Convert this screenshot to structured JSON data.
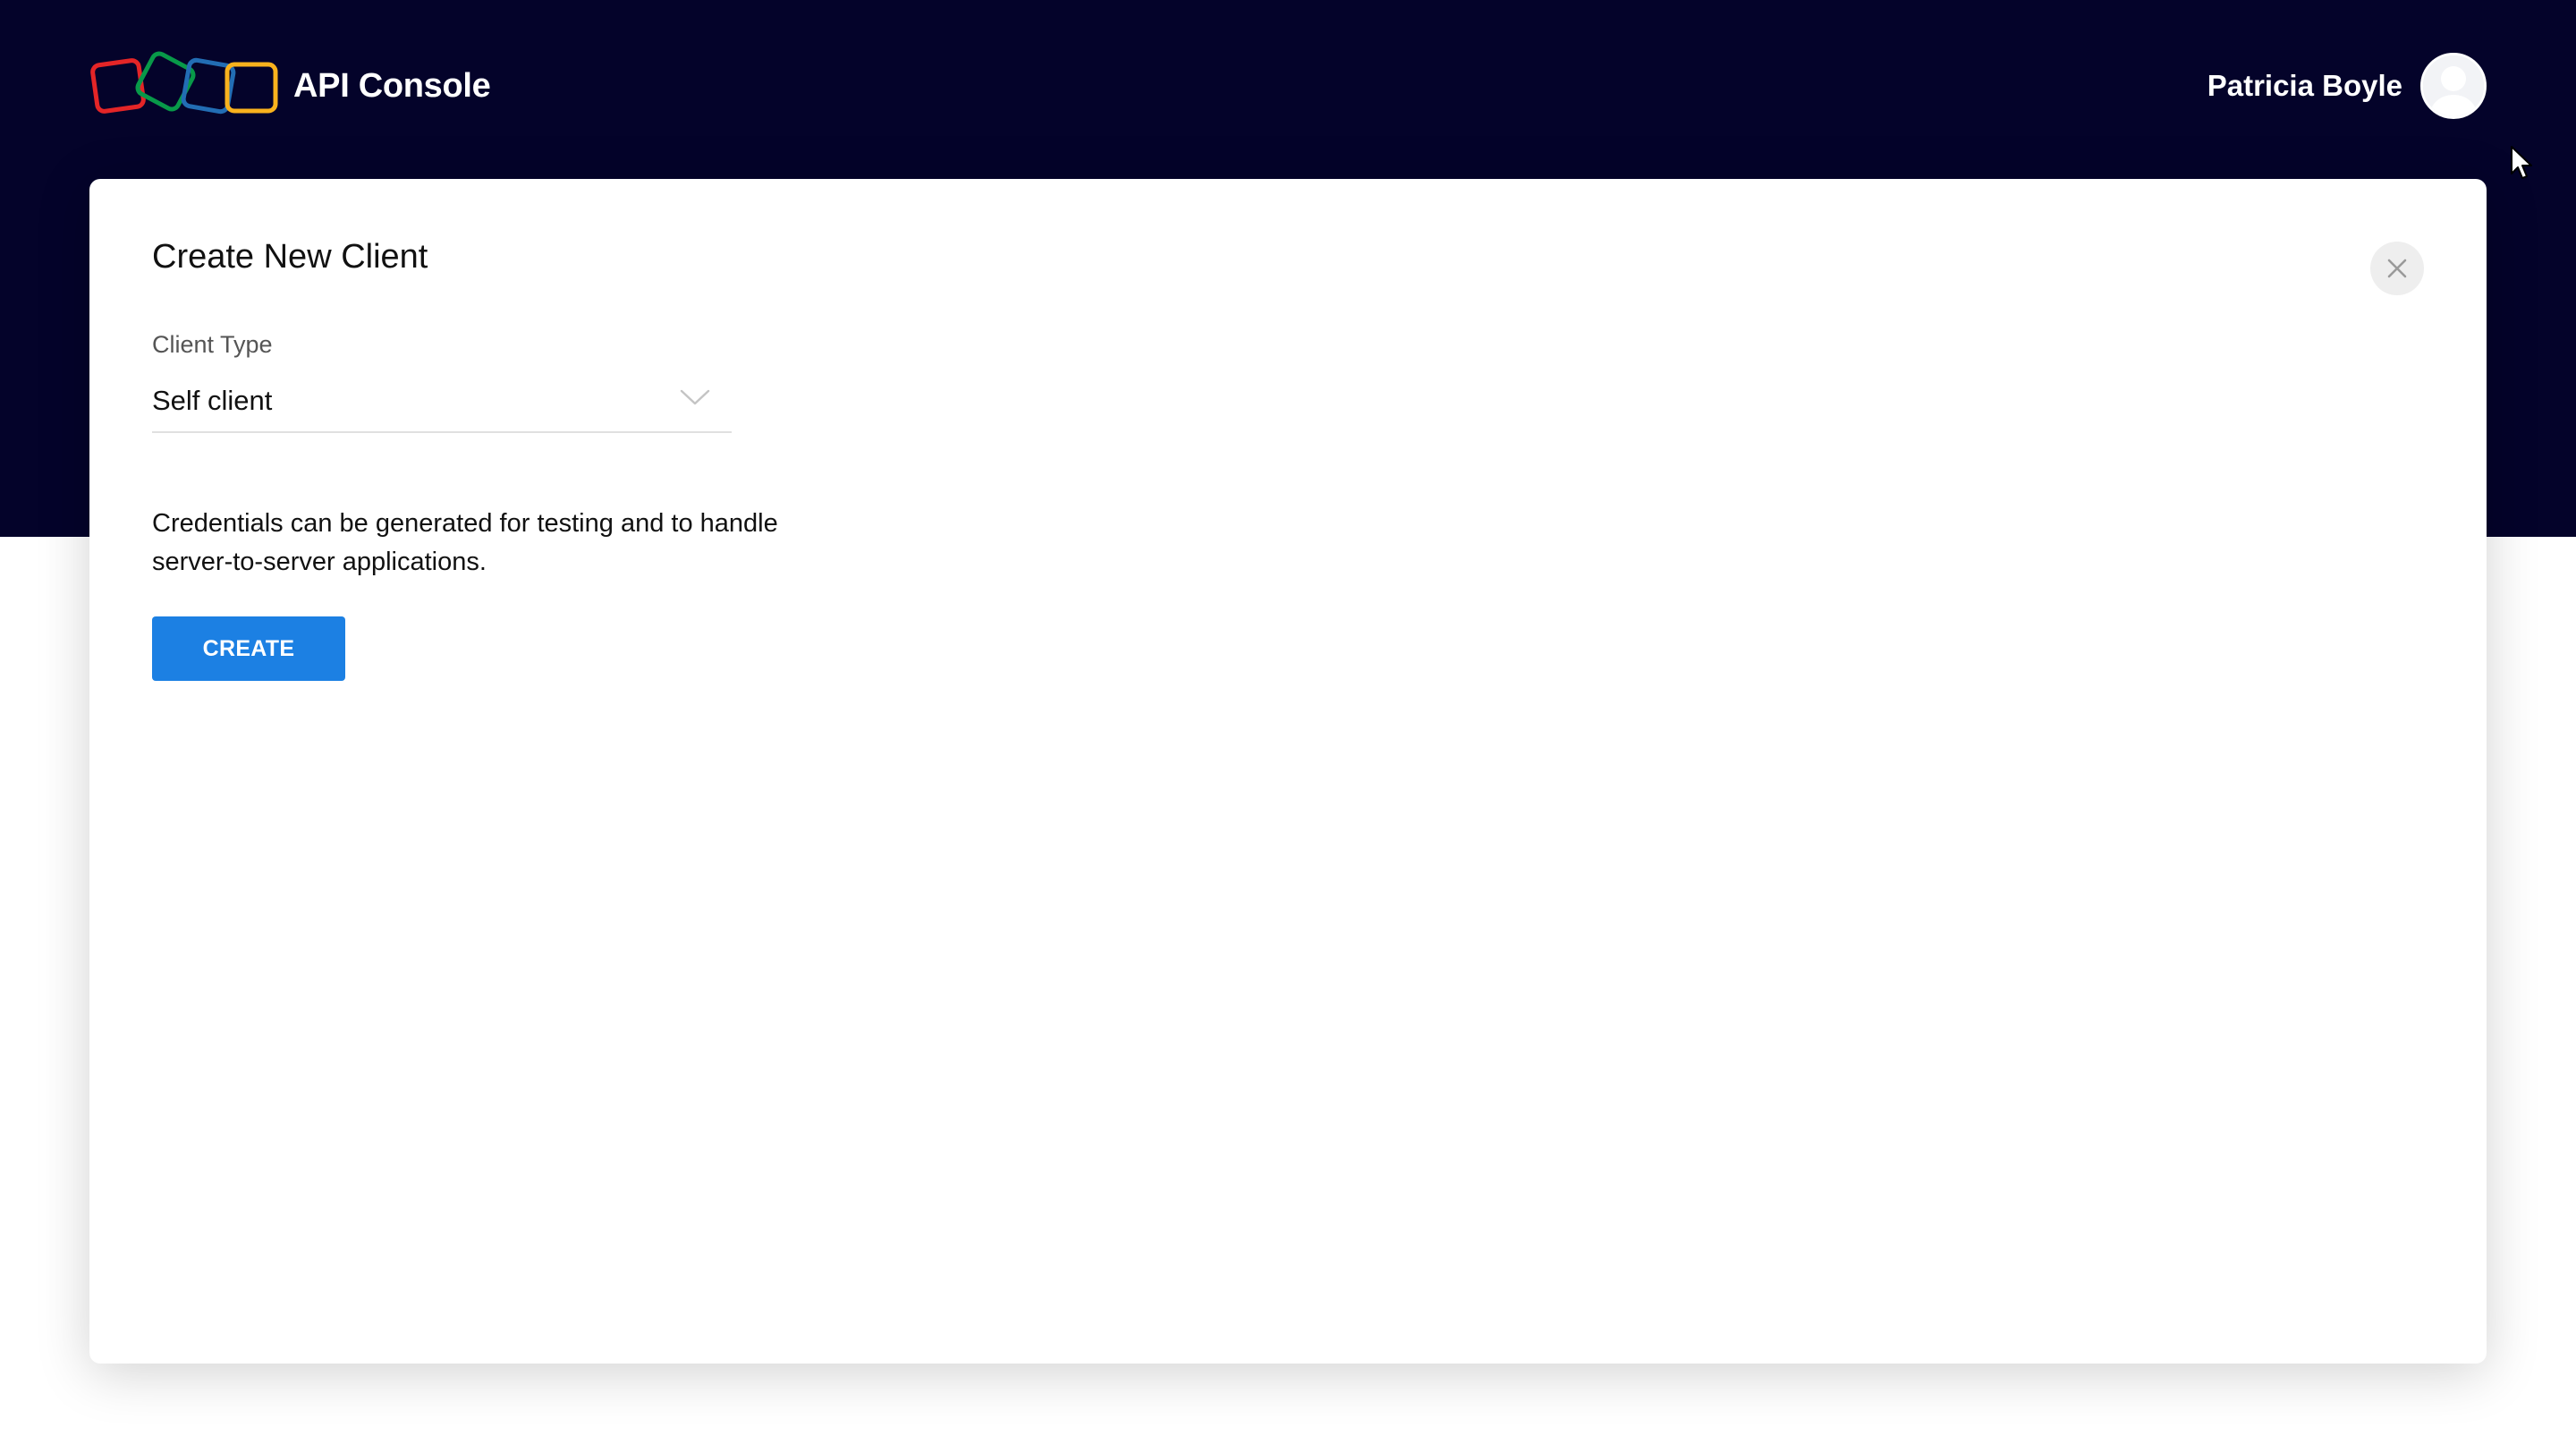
{
  "header": {
    "app_title": "API Console",
    "logo_icon": "zoho-logo-icon",
    "user_name": "Patricia Boyle",
    "avatar_icon": "user-avatar-icon"
  },
  "modal": {
    "title": "Create New Client",
    "close_icon": "close-icon",
    "client_type": {
      "label": "Client Type",
      "selected_value": "Self client",
      "chevron_icon": "chevron-down-icon"
    },
    "description_lines": [
      "Credentials can be generated for testing and to handle",
      "server-to-server applications."
    ],
    "create_button_label": "CREATE"
  },
  "colors": {
    "header_background": "#04032a",
    "primary_button": "#1c80e3",
    "logo_red": "#e42527",
    "logo_green": "#089949",
    "logo_blue": "#226db4",
    "logo_yellow": "#f9b21d"
  }
}
